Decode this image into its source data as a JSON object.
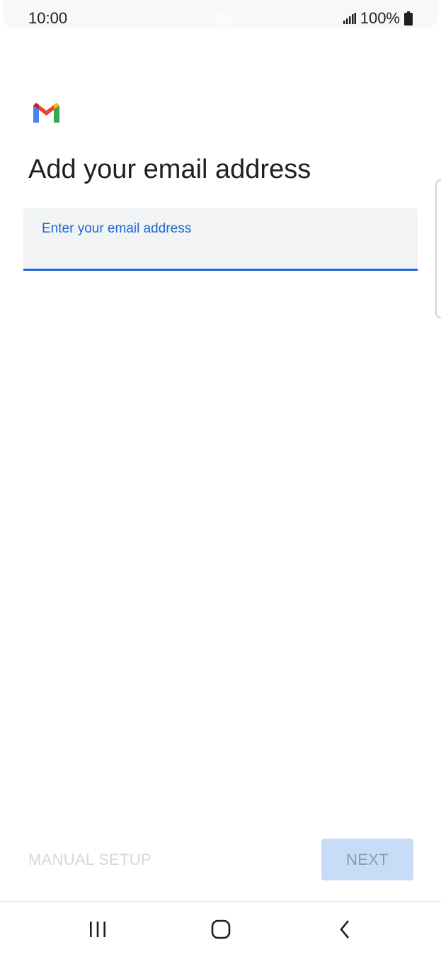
{
  "status_bar": {
    "time": "10:00",
    "battery": "100%",
    "icons": [
      "signal-icon",
      "battery-icon"
    ]
  },
  "app": {
    "logo": "gmail-logo-icon",
    "brand_colors": {
      "blue": "#4285F4",
      "red": "#EA4335",
      "yellow": "#FBBC04",
      "green": "#34A853",
      "dark_red": "#C5221F"
    }
  },
  "main": {
    "title": "Add your email address",
    "email_field": {
      "label": "Enter your email address",
      "value": "",
      "accent": "#1a67d2"
    }
  },
  "footer": {
    "manual_setup_label": "MANUAL SETUP",
    "next_label": "NEXT"
  },
  "nav_bar": {
    "icons": [
      "recents-icon",
      "home-icon",
      "back-icon"
    ]
  }
}
